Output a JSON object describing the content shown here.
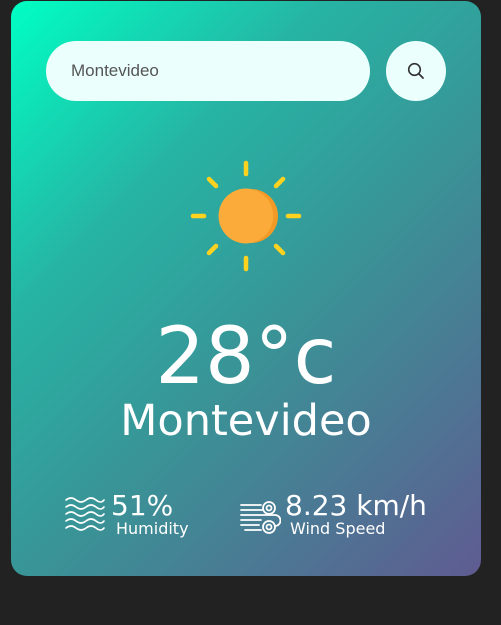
{
  "search": {
    "value": "Montevideo",
    "icon": "search-icon"
  },
  "weather": {
    "icon": "sun-icon",
    "temperature": "28°c",
    "city": "Montevideo"
  },
  "details": {
    "humidity": {
      "value": "51%",
      "label": "Humidity",
      "icon": "humidity-icon"
    },
    "wind": {
      "value": "8.23 km/h",
      "label": "Wind Speed",
      "icon": "wind-icon"
    }
  },
  "colors": {
    "page_background": "#222222",
    "gradient_start": "#00ffc3",
    "gradient_end": "#5f5b91",
    "input_background": "#ebfffc",
    "sun": "#fbab3a",
    "sun_rays": "#ffd21f",
    "text": "#ffffff"
  }
}
